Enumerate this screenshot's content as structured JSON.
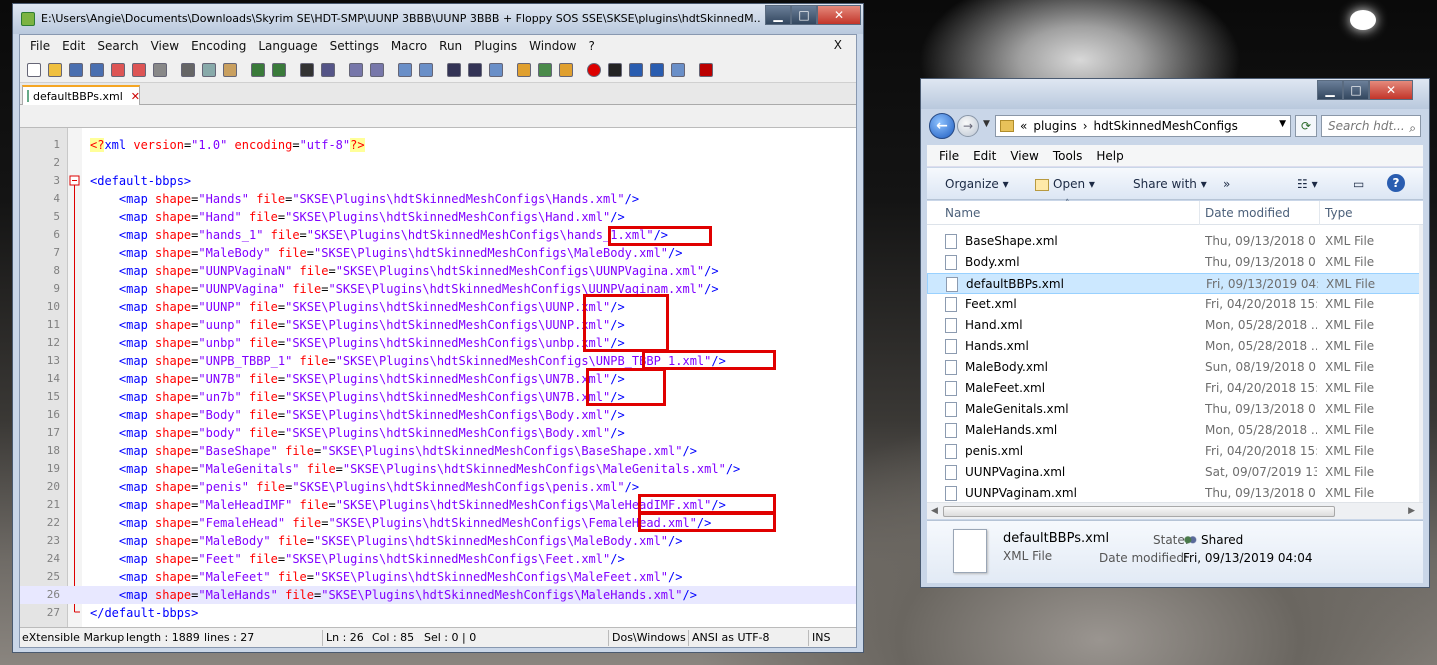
{
  "npp": {
    "title": "E:\\Users\\Angie\\Documents\\Downloads\\Skyrim SE\\HDT-SMP\\UUNP 3BBB\\UUNP 3BBB + Floppy SOS SSE\\SKSE\\plugins\\hdtSkinnedM...",
    "menu": [
      "File",
      "Edit",
      "Search",
      "View",
      "Encoding",
      "Language",
      "Settings",
      "Macro",
      "Run",
      "Plugins",
      "Window",
      "?"
    ],
    "menu_close": "X",
    "tab_label": "defaultBBPs.xml",
    "lines": [
      {
        "n": "1",
        "segs": [
          [
            "pi",
            "<?"
          ],
          [
            "tag",
            "xml "
          ],
          [
            "attr",
            "version"
          ],
          [
            "plain",
            "="
          ],
          [
            "val",
            "\"1.0\" "
          ],
          [
            "attr",
            "encoding"
          ],
          [
            "plain",
            "="
          ],
          [
            "val",
            "\"utf-8\""
          ],
          [
            "pi",
            "?>"
          ]
        ]
      },
      {
        "n": "2",
        "segs": []
      },
      {
        "n": "3",
        "segs": [
          [
            "tag",
            "<default-bbps>"
          ]
        ]
      },
      {
        "n": "4",
        "segs": [
          [
            "plain",
            "    "
          ],
          [
            "tag",
            "<map "
          ],
          [
            "attr",
            "shape"
          ],
          [
            "plain",
            "="
          ],
          [
            "val",
            "\"Hands\" "
          ],
          [
            "attr",
            "file"
          ],
          [
            "plain",
            "="
          ],
          [
            "val",
            "\"SKSE\\Plugins\\hdtSkinnedMeshConfigs\\Hands.xml\""
          ],
          [
            "tag",
            "/>"
          ]
        ]
      },
      {
        "n": "5",
        "segs": [
          [
            "plain",
            "    "
          ],
          [
            "tag",
            "<map "
          ],
          [
            "attr",
            "shape"
          ],
          [
            "plain",
            "="
          ],
          [
            "val",
            "\"Hand\" "
          ],
          [
            "attr",
            "file"
          ],
          [
            "plain",
            "="
          ],
          [
            "val",
            "\"SKSE\\Plugins\\hdtSkinnedMeshConfigs\\Hand.xml\""
          ],
          [
            "tag",
            "/>"
          ]
        ]
      },
      {
        "n": "6",
        "segs": [
          [
            "plain",
            "    "
          ],
          [
            "tag",
            "<map "
          ],
          [
            "attr",
            "shape"
          ],
          [
            "plain",
            "="
          ],
          [
            "val",
            "\"hands_1\" "
          ],
          [
            "attr",
            "file"
          ],
          [
            "plain",
            "="
          ],
          [
            "val",
            "\"SKSE\\Plugins\\hdtSkinnedMeshConfigs\\hands_1.xml\""
          ],
          [
            "tag",
            "/>"
          ]
        ]
      },
      {
        "n": "7",
        "segs": [
          [
            "plain",
            "    "
          ],
          [
            "tag",
            "<map "
          ],
          [
            "attr",
            "shape"
          ],
          [
            "plain",
            "="
          ],
          [
            "val",
            "\"MaleBody\" "
          ],
          [
            "attr",
            "file"
          ],
          [
            "plain",
            "="
          ],
          [
            "val",
            "\"SKSE\\Plugins\\hdtSkinnedMeshConfigs\\MaleBody.xml\""
          ],
          [
            "tag",
            "/>"
          ]
        ]
      },
      {
        "n": "8",
        "segs": [
          [
            "plain",
            "    "
          ],
          [
            "tag",
            "<map "
          ],
          [
            "attr",
            "shape"
          ],
          [
            "plain",
            "="
          ],
          [
            "val",
            "\"UUNPVaginaN\" "
          ],
          [
            "attr",
            "file"
          ],
          [
            "plain",
            "="
          ],
          [
            "val",
            "\"SKSE\\Plugins\\hdtSkinnedMeshConfigs\\UUNPVagina.xml\""
          ],
          [
            "tag",
            "/>"
          ]
        ]
      },
      {
        "n": "9",
        "segs": [
          [
            "plain",
            "    "
          ],
          [
            "tag",
            "<map "
          ],
          [
            "attr",
            "shape"
          ],
          [
            "plain",
            "="
          ],
          [
            "val",
            "\"UUNPVagina\" "
          ],
          [
            "attr",
            "file"
          ],
          [
            "plain",
            "="
          ],
          [
            "val",
            "\"SKSE\\Plugins\\hdtSkinnedMeshConfigs\\UUNPVaginam.xml\""
          ],
          [
            "tag",
            "/>"
          ]
        ]
      },
      {
        "n": "10",
        "segs": [
          [
            "plain",
            "    "
          ],
          [
            "tag",
            "<map "
          ],
          [
            "attr",
            "shape"
          ],
          [
            "plain",
            "="
          ],
          [
            "val",
            "\"UUNP\" "
          ],
          [
            "attr",
            "file"
          ],
          [
            "plain",
            "="
          ],
          [
            "val",
            "\"SKSE\\Plugins\\hdtSkinnedMeshConfigs\\UUNP.xml\""
          ],
          [
            "tag",
            "/>"
          ]
        ]
      },
      {
        "n": "11",
        "segs": [
          [
            "plain",
            "    "
          ],
          [
            "tag",
            "<map "
          ],
          [
            "attr",
            "shape"
          ],
          [
            "plain",
            "="
          ],
          [
            "val",
            "\"uunp\" "
          ],
          [
            "attr",
            "file"
          ],
          [
            "plain",
            "="
          ],
          [
            "val",
            "\"SKSE\\Plugins\\hdtSkinnedMeshConfigs\\UUNP.xml\""
          ],
          [
            "tag",
            "/>"
          ]
        ]
      },
      {
        "n": "12",
        "segs": [
          [
            "plain",
            "    "
          ],
          [
            "tag",
            "<map "
          ],
          [
            "attr",
            "shape"
          ],
          [
            "plain",
            "="
          ],
          [
            "val",
            "\"unbp\" "
          ],
          [
            "attr",
            "file"
          ],
          [
            "plain",
            "="
          ],
          [
            "val",
            "\"SKSE\\Plugins\\hdtSkinnedMeshConfigs\\unbp.xml\""
          ],
          [
            "tag",
            "/>"
          ]
        ]
      },
      {
        "n": "13",
        "segs": [
          [
            "plain",
            "    "
          ],
          [
            "tag",
            "<map "
          ],
          [
            "attr",
            "shape"
          ],
          [
            "plain",
            "="
          ],
          [
            "val",
            "\"UNPB_TBBP_1\" "
          ],
          [
            "attr",
            "file"
          ],
          [
            "plain",
            "="
          ],
          [
            "val",
            "\"SKSE\\Plugins\\hdtSkinnedMeshConfigs\\UNPB_TBBP_1.xml\""
          ],
          [
            "tag",
            "/>"
          ]
        ]
      },
      {
        "n": "14",
        "segs": [
          [
            "plain",
            "    "
          ],
          [
            "tag",
            "<map "
          ],
          [
            "attr",
            "shape"
          ],
          [
            "plain",
            "="
          ],
          [
            "val",
            "\"UN7B\" "
          ],
          [
            "attr",
            "file"
          ],
          [
            "plain",
            "="
          ],
          [
            "val",
            "\"SKSE\\Plugins\\hdtSkinnedMeshConfigs\\UN7B.xml\""
          ],
          [
            "tag",
            "/>"
          ]
        ]
      },
      {
        "n": "15",
        "segs": [
          [
            "plain",
            "    "
          ],
          [
            "tag",
            "<map "
          ],
          [
            "attr",
            "shape"
          ],
          [
            "plain",
            "="
          ],
          [
            "val",
            "\"un7b\" "
          ],
          [
            "attr",
            "file"
          ],
          [
            "plain",
            "="
          ],
          [
            "val",
            "\"SKSE\\Plugins\\hdtSkinnedMeshConfigs\\UN7B.xml\""
          ],
          [
            "tag",
            "/>"
          ]
        ]
      },
      {
        "n": "16",
        "segs": [
          [
            "plain",
            "    "
          ],
          [
            "tag",
            "<map "
          ],
          [
            "attr",
            "shape"
          ],
          [
            "plain",
            "="
          ],
          [
            "val",
            "\"Body\" "
          ],
          [
            "attr",
            "file"
          ],
          [
            "plain",
            "="
          ],
          [
            "val",
            "\"SKSE\\Plugins\\hdtSkinnedMeshConfigs\\Body.xml\""
          ],
          [
            "tag",
            "/>"
          ]
        ]
      },
      {
        "n": "17",
        "segs": [
          [
            "plain",
            "    "
          ],
          [
            "tag",
            "<map "
          ],
          [
            "attr",
            "shape"
          ],
          [
            "plain",
            "="
          ],
          [
            "val",
            "\"body\" "
          ],
          [
            "attr",
            "file"
          ],
          [
            "plain",
            "="
          ],
          [
            "val",
            "\"SKSE\\Plugins\\hdtSkinnedMeshConfigs\\Body.xml\""
          ],
          [
            "tag",
            "/>"
          ]
        ]
      },
      {
        "n": "18",
        "segs": [
          [
            "plain",
            "    "
          ],
          [
            "tag",
            "<map "
          ],
          [
            "attr",
            "shape"
          ],
          [
            "plain",
            "="
          ],
          [
            "val",
            "\"BaseShape\" "
          ],
          [
            "attr",
            "file"
          ],
          [
            "plain",
            "="
          ],
          [
            "val",
            "\"SKSE\\Plugins\\hdtSkinnedMeshConfigs\\BaseShape.xml\""
          ],
          [
            "tag",
            "/>"
          ]
        ]
      },
      {
        "n": "19",
        "segs": [
          [
            "plain",
            "    "
          ],
          [
            "tag",
            "<map "
          ],
          [
            "attr",
            "shape"
          ],
          [
            "plain",
            "="
          ],
          [
            "val",
            "\"MaleGenitals\" "
          ],
          [
            "attr",
            "file"
          ],
          [
            "plain",
            "="
          ],
          [
            "val",
            "\"SKSE\\Plugins\\hdtSkinnedMeshConfigs\\MaleGenitals.xml\""
          ],
          [
            "tag",
            "/>"
          ]
        ]
      },
      {
        "n": "20",
        "segs": [
          [
            "plain",
            "    "
          ],
          [
            "tag",
            "<map "
          ],
          [
            "attr",
            "shape"
          ],
          [
            "plain",
            "="
          ],
          [
            "val",
            "\"penis\" "
          ],
          [
            "attr",
            "file"
          ],
          [
            "plain",
            "="
          ],
          [
            "val",
            "\"SKSE\\Plugins\\hdtSkinnedMeshConfigs\\penis.xml\""
          ],
          [
            "tag",
            "/>"
          ]
        ]
      },
      {
        "n": "21",
        "segs": [
          [
            "plain",
            "    "
          ],
          [
            "tag",
            "<map "
          ],
          [
            "attr",
            "shape"
          ],
          [
            "plain",
            "="
          ],
          [
            "val",
            "\"MaleHeadIMF\" "
          ],
          [
            "attr",
            "file"
          ],
          [
            "plain",
            "="
          ],
          [
            "val",
            "\"SKSE\\Plugins\\hdtSkinnedMeshConfigs\\MaleHeadIMF.xml\""
          ],
          [
            "tag",
            "/>"
          ]
        ]
      },
      {
        "n": "22",
        "segs": [
          [
            "plain",
            "    "
          ],
          [
            "tag",
            "<map "
          ],
          [
            "attr",
            "shape"
          ],
          [
            "plain",
            "="
          ],
          [
            "val",
            "\"FemaleHead\" "
          ],
          [
            "attr",
            "file"
          ],
          [
            "plain",
            "="
          ],
          [
            "val",
            "\"SKSE\\Plugins\\hdtSkinnedMeshConfigs\\FemaleHead.xml\""
          ],
          [
            "tag",
            "/>"
          ]
        ]
      },
      {
        "n": "23",
        "segs": [
          [
            "plain",
            "    "
          ],
          [
            "tag",
            "<map "
          ],
          [
            "attr",
            "shape"
          ],
          [
            "plain",
            "="
          ],
          [
            "val",
            "\"MaleBody\" "
          ],
          [
            "attr",
            "file"
          ],
          [
            "plain",
            "="
          ],
          [
            "val",
            "\"SKSE\\Plugins\\hdtSkinnedMeshConfigs\\MaleBody.xml\""
          ],
          [
            "tag",
            "/>"
          ]
        ]
      },
      {
        "n": "24",
        "segs": [
          [
            "plain",
            "    "
          ],
          [
            "tag",
            "<map "
          ],
          [
            "attr",
            "shape"
          ],
          [
            "plain",
            "="
          ],
          [
            "val",
            "\"Feet\" "
          ],
          [
            "attr",
            "file"
          ],
          [
            "plain",
            "="
          ],
          [
            "val",
            "\"SKSE\\Plugins\\hdtSkinnedMeshConfigs\\Feet.xml\""
          ],
          [
            "tag",
            "/>"
          ]
        ]
      },
      {
        "n": "25",
        "segs": [
          [
            "plain",
            "    "
          ],
          [
            "tag",
            "<map "
          ],
          [
            "attr",
            "shape"
          ],
          [
            "plain",
            "="
          ],
          [
            "val",
            "\"MaleFeet\" "
          ],
          [
            "attr",
            "file"
          ],
          [
            "plain",
            "="
          ],
          [
            "val",
            "\"SKSE\\Plugins\\hdtSkinnedMeshConfigs\\MaleFeet.xml\""
          ],
          [
            "tag",
            "/>"
          ]
        ]
      },
      {
        "n": "26",
        "segs": [
          [
            "plain",
            "    "
          ],
          [
            "tag",
            "<map "
          ],
          [
            "attr",
            "shape"
          ],
          [
            "plain",
            "="
          ],
          [
            "val",
            "\"MaleHands\" "
          ],
          [
            "attr",
            "file"
          ],
          [
            "plain",
            "="
          ],
          [
            "val",
            "\"SKSE\\Plugins\\hdtSkinnedMeshConfigs\\MaleHands.xml\""
          ],
          [
            "tag",
            "/>"
          ]
        ]
      },
      {
        "n": "27",
        "segs": [
          [
            "tag",
            "</default-bbps>"
          ]
        ]
      }
    ],
    "status": {
      "lang": "eXtensible Markup",
      "length": "length : 1889",
      "lines": "lines : 27",
      "ln": "Ln : 26",
      "col": "Col : 85",
      "sel": "Sel : 0 | 0",
      "eol": "Dos\\Windows",
      "enc": "ANSI as UTF-8",
      "mode": "INS"
    }
  },
  "explorer": {
    "address": [
      "«",
      "plugins",
      "›",
      "hdtSkinnedMeshConfigs"
    ],
    "search_placeholder": "Search hdt...",
    "menu": [
      "File",
      "Edit",
      "View",
      "Tools",
      "Help"
    ],
    "commands": {
      "organize": "Organize",
      "open": "Open",
      "share": "Share with",
      "more": "»"
    },
    "columns": {
      "name": "Name",
      "date": "Date modified",
      "type": "Type"
    },
    "files": [
      {
        "name": "BaseShape.xml",
        "date": "Thu, 09/13/2018 0...",
        "type": "XML File"
      },
      {
        "name": "Body.xml",
        "date": "Thu, 09/13/2018 0...",
        "type": "XML File"
      },
      {
        "name": "defaultBBPs.xml",
        "date": "Fri, 09/13/2019 04:...",
        "type": "XML File",
        "selected": true
      },
      {
        "name": "Feet.xml",
        "date": "Fri, 04/20/2018 15:...",
        "type": "XML File"
      },
      {
        "name": "Hand.xml",
        "date": "Mon, 05/28/2018 ...",
        "type": "XML File"
      },
      {
        "name": "Hands.xml",
        "date": "Mon, 05/28/2018 ...",
        "type": "XML File"
      },
      {
        "name": "MaleBody.xml",
        "date": "Sun, 08/19/2018 0...",
        "type": "XML File"
      },
      {
        "name": "MaleFeet.xml",
        "date": "Fri, 04/20/2018 15:...",
        "type": "XML File"
      },
      {
        "name": "MaleGenitals.xml",
        "date": "Thu, 09/13/2018 0...",
        "type": "XML File"
      },
      {
        "name": "MaleHands.xml",
        "date": "Mon, 05/28/2018 ...",
        "type": "XML File"
      },
      {
        "name": "penis.xml",
        "date": "Fri, 04/20/2018 15:...",
        "type": "XML File"
      },
      {
        "name": "UUNPVagina.xml",
        "date": "Sat, 09/07/2019 13...",
        "type": "XML File"
      },
      {
        "name": "UUNPVaginam.xml",
        "date": "Thu, 09/13/2018 0...",
        "type": "XML File"
      }
    ],
    "details": {
      "name": "defaultBBPs.xml",
      "type": "XML File",
      "state_label": "State:",
      "state_value": "Shared",
      "date_label": "Date modified:",
      "date_value": "Fri, 09/13/2019 04:04"
    }
  },
  "colors": {
    "highlight_box": "#e00000",
    "xml_tag": "#0000ff",
    "xml_attr": "#ff0000",
    "xml_value": "#8000ff"
  }
}
